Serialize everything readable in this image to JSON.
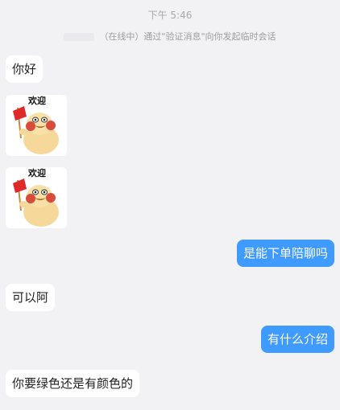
{
  "chat": {
    "timestamp": "下午 5:46",
    "system_notice": "（在线中）通过\"验证消息\"向你发起临时会话",
    "messages": [
      {
        "side": "left",
        "type": "text",
        "text": "你好"
      },
      {
        "side": "left",
        "type": "sticker",
        "caption": "欢迎",
        "icon": "welcome-chick-sticker"
      },
      {
        "side": "left",
        "type": "sticker",
        "caption": "欢迎",
        "icon": "welcome-chick-sticker"
      },
      {
        "side": "right",
        "type": "text",
        "text": "是能下单陪聊吗"
      },
      {
        "side": "left",
        "type": "text",
        "text": "可以阿"
      },
      {
        "side": "right",
        "type": "text",
        "text": "有什么介绍"
      },
      {
        "side": "left",
        "type": "text",
        "text": "你要绿色还是有颜色的"
      }
    ]
  },
  "colors": {
    "background": "#f2f2f4",
    "incoming_bubble": "#ffffff",
    "outgoing_bubble": "#3f9bff"
  }
}
